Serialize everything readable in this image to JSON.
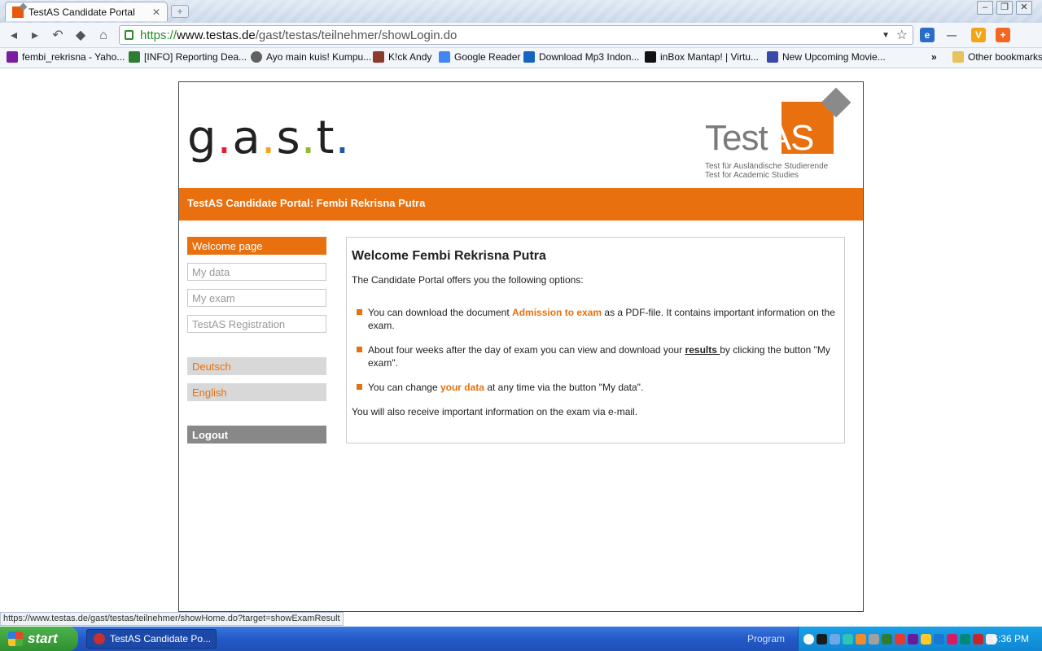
{
  "browser": {
    "tab_title": "TestAS Candidate Portal",
    "url_scheme": "https://",
    "url_host": "www.testas.de",
    "url_path": "/gast/testas/teilnehmer/showLogin.do",
    "bookmarks": [
      {
        "label": "fembi_rekrisna - Yaho...",
        "icon": "yahoo-icon",
        "color": "#7b1fa2"
      },
      {
        "label": "[INFO] Reporting Dea...",
        "icon": "forum-icon",
        "color": "#2e7d32"
      },
      {
        "label": "Ayo main kuis! Kumpu...",
        "icon": "globe-icon",
        "color": "#616161"
      },
      {
        "label": "K!ck Andy",
        "icon": "kickandy-icon",
        "color": "#8d3b2b"
      },
      {
        "label": "Google Reader",
        "icon": "google-icon",
        "color": "#4285f4"
      },
      {
        "label": "Download Mp3 Indon...",
        "icon": "music-icon",
        "color": "#1565c0"
      },
      {
        "label": "inBox Mantap! | Virtu...",
        "icon": "inbox-icon",
        "color": "#111111"
      },
      {
        "label": "New Upcoming Movie...",
        "icon": "film-icon",
        "color": "#3949ab"
      }
    ],
    "other_bookmarks": "Other bookmarks",
    "status_url": "https://www.testas.de/gast/testas/teilnehmer/showHome.do?target=showExamResult"
  },
  "header": {
    "gast_logo": [
      "g",
      ".",
      "a",
      ".",
      "s",
      ".",
      "t",
      "."
    ],
    "testas_word": "Test",
    "testas_as": "AS",
    "testas_sub1": "Test für Ausländische Studierende",
    "testas_sub2": "Test for Academic Studies",
    "banner": "TestAS Candidate Portal: Fembi Rekrisna Putra"
  },
  "nav": {
    "welcome": "Welcome page",
    "my_data": "My data",
    "my_exam": "My exam",
    "registration": "TestAS Registration",
    "deutsch": "Deutsch",
    "english": "English",
    "logout": "Logout"
  },
  "content": {
    "heading": "Welcome Fembi Rekrisna Putra",
    "intro": "The Candidate Portal offers you the following options:",
    "item1_pre": "You can download the document ",
    "item1_link": "Admission to exam",
    "item1_post": " as a PDF-file. It contains important information on the exam.",
    "item2_pre": "About four weeks after the day of exam you can view and download your ",
    "item2_link": "results ",
    "item2_post": "by clicking the button \"My exam\".",
    "item3_pre": "You can change ",
    "item3_link": "your data",
    "item3_post": " at any time via the button \"My data\".",
    "footer": "You will also receive important information on the exam via e-mail."
  },
  "taskbar": {
    "start": "start",
    "task": "TestAS Candidate Po...",
    "program": "Program",
    "clock": "6:36 PM"
  },
  "colors": {
    "accent": "#e8700e",
    "nav_lang_bg": "#d8d8d8",
    "logout_bg": "#888888"
  }
}
